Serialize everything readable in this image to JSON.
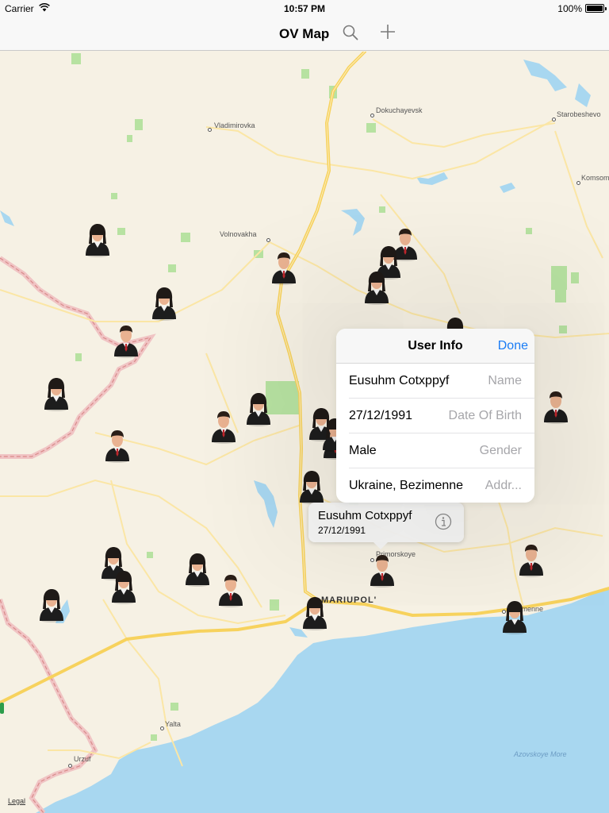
{
  "status_bar": {
    "carrier": "Carrier",
    "time": "10:57 PM",
    "battery_pct": "100%",
    "battery_level": 1.0
  },
  "nav": {
    "title": "OV Map",
    "search_icon": "search-icon",
    "add_icon": "plus-icon"
  },
  "map": {
    "places": [
      {
        "name": "Dokuchayevsk",
        "kind": "town"
      },
      {
        "name": "Starobeshevo",
        "kind": "town"
      },
      {
        "name": "Vladimirovka",
        "kind": "town"
      },
      {
        "name": "Komsomolske",
        "kind": "town"
      },
      {
        "name": "Volnovakha",
        "kind": "town"
      },
      {
        "name": "Primorskoye",
        "kind": "town"
      },
      {
        "name": "MARIUPOL'",
        "kind": "city"
      },
      {
        "name": "Bezimenne",
        "kind": "town"
      },
      {
        "name": "Yalta",
        "kind": "town"
      },
      {
        "name": "Urzuf",
        "kind": "town"
      },
      {
        "name": "Azovskoye More",
        "kind": "sea"
      }
    ],
    "legal": "Legal"
  },
  "pins": [
    {
      "gender": "female"
    },
    {
      "gender": "male"
    },
    {
      "gender": "male"
    },
    {
      "gender": "female"
    },
    {
      "gender": "female"
    },
    {
      "gender": "female"
    },
    {
      "gender": "male"
    },
    {
      "gender": "female"
    },
    {
      "gender": "female"
    },
    {
      "gender": "male"
    },
    {
      "gender": "male"
    },
    {
      "gender": "female"
    },
    {
      "gender": "female"
    },
    {
      "gender": "male"
    },
    {
      "gender": "female"
    },
    {
      "gender": "female"
    },
    {
      "gender": "female"
    },
    {
      "gender": "female"
    },
    {
      "gender": "female"
    },
    {
      "gender": "male"
    },
    {
      "gender": "female"
    },
    {
      "gender": "male"
    },
    {
      "gender": "male"
    },
    {
      "gender": "male"
    },
    {
      "gender": "female"
    },
    {
      "gender": "female"
    }
  ],
  "callout": {
    "name": "Eusuhm Cotxppyf",
    "date": "27/12/1991",
    "icon": "info-icon"
  },
  "user_info": {
    "title": "User Info",
    "done_label": "Done",
    "fields": [
      {
        "value": "Eusuhm Cotxppyf",
        "placeholder": "Name"
      },
      {
        "value": "27/12/1991",
        "placeholder": "Date Of Birth"
      },
      {
        "value": "Male",
        "placeholder": "Gender"
      },
      {
        "value": "Ukraine, Bezimenne",
        "placeholder": "Addr..."
      }
    ]
  },
  "colors": {
    "accent": "#1a7cf5",
    "land": "#f6f1e4",
    "sea": "#a8d7f0",
    "road_major": "#f7d25d",
    "road_minor": "#fbe6a5",
    "border": "#e8a2a2",
    "park": "#b7e2a1"
  }
}
